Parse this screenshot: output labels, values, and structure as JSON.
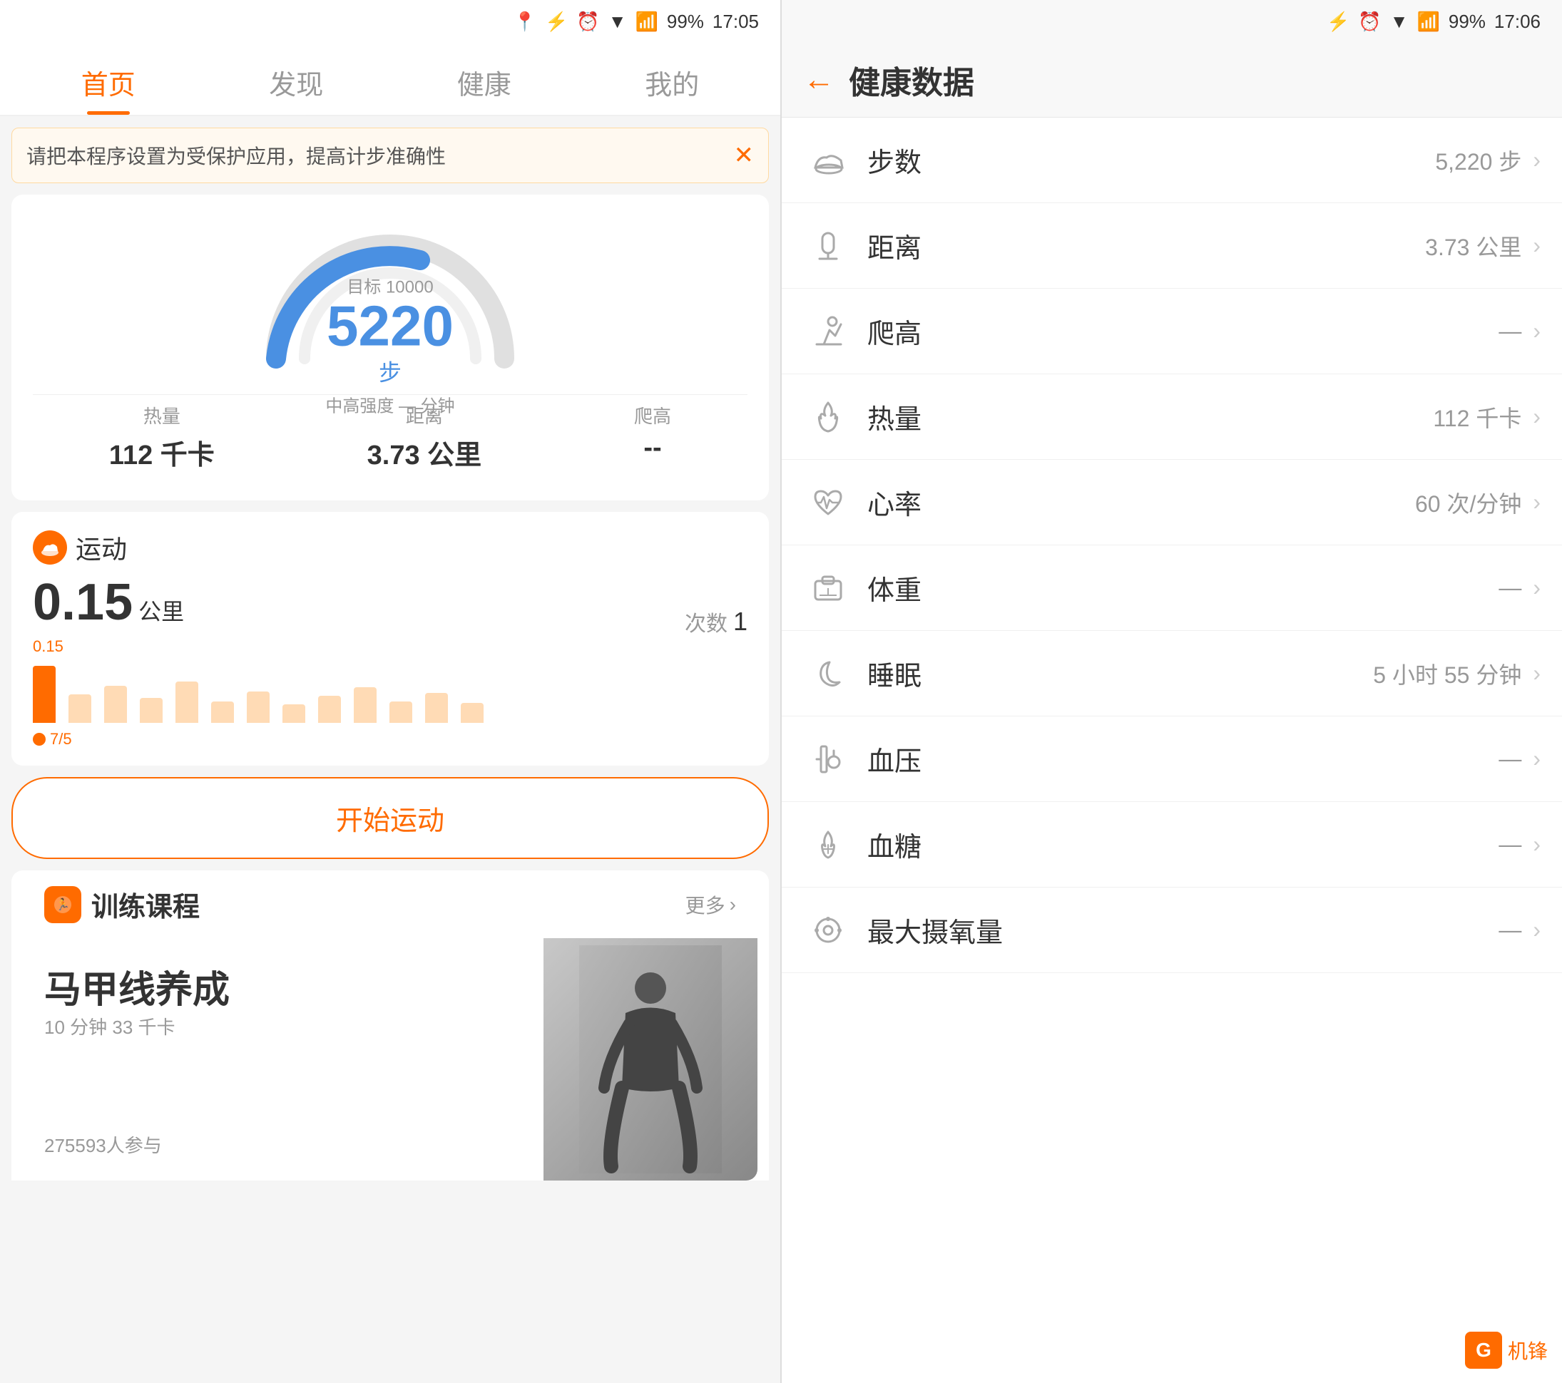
{
  "left": {
    "status_bar": {
      "battery": "99%",
      "time": "17:05"
    },
    "nav": {
      "tabs": [
        "首页",
        "发现",
        "健康",
        "我的"
      ],
      "active": 0
    },
    "notification": {
      "text": "请把本程序设置为受保护应用，提高计步准确性",
      "close": "✕"
    },
    "steps_card": {
      "target_label": "目标 10000",
      "steps_value": "5220",
      "steps_unit": "步",
      "intensity": "中高强度 — 分钟",
      "stats": [
        {
          "label": "热量",
          "value": "112 千卡"
        },
        {
          "label": "距离",
          "value": "3.73 公里"
        },
        {
          "label": "爬高",
          "value": "--"
        }
      ]
    },
    "exercise_card": {
      "title": "运动",
      "distance": "0.15",
      "unit": "公里",
      "count_label": "次数",
      "count_value": "1",
      "chart_label": "0.15",
      "chart_date": "7/5",
      "bars": [
        80,
        40,
        50,
        35,
        55,
        30,
        45,
        25,
        38,
        50,
        30,
        42,
        28
      ]
    },
    "start_button": "开始运动",
    "training": {
      "title": "训练课程",
      "more": "更多",
      "course": {
        "title": "马甲线养成",
        "meta": "10 分钟    33 千卡",
        "participants": "275593",
        "participants_label": "人参与"
      }
    }
  },
  "right": {
    "status_bar": {
      "battery": "99%",
      "time": "17:06"
    },
    "header": {
      "back": "←",
      "title": "健康数据"
    },
    "items": [
      {
        "icon": "shoe-icon",
        "name": "步数",
        "value": "5,220 步",
        "has_value": true
      },
      {
        "icon": "distance-icon",
        "name": "距离",
        "value": "3.73 公里",
        "has_value": true
      },
      {
        "icon": "climb-icon",
        "name": "爬高",
        "value": "—",
        "has_value": false
      },
      {
        "icon": "calorie-icon",
        "name": "热量",
        "value": "112 千卡",
        "has_value": true
      },
      {
        "icon": "heart-icon",
        "name": "心率",
        "value": "60 次/分钟",
        "has_value": true
      },
      {
        "icon": "weight-icon",
        "name": "体重",
        "value": "—",
        "has_value": false
      },
      {
        "icon": "sleep-icon",
        "name": "睡眠",
        "value": "5 小时 55 分钟",
        "has_value": true
      },
      {
        "icon": "bp-icon",
        "name": "血压",
        "value": "—",
        "has_value": false
      },
      {
        "icon": "blood-sugar-icon",
        "name": "血糖",
        "value": "—",
        "has_value": false
      },
      {
        "icon": "vo2-icon",
        "name": "最大摄氧量",
        "value": "—",
        "has_value": false
      }
    ]
  },
  "watermark": {
    "logo": "G",
    "text": "机锋"
  }
}
